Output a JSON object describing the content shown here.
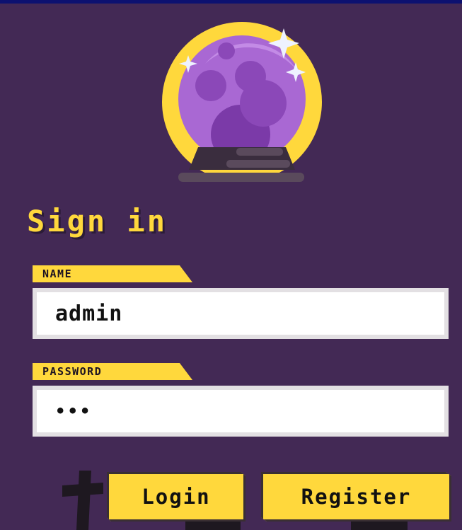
{
  "page": {
    "title": "Sign in"
  },
  "form": {
    "name_label": "NAME",
    "name_value": "admin",
    "password_label": "PASSWORD",
    "password_value": "•••"
  },
  "actions": {
    "login_label": "Login",
    "register_label": "Register"
  },
  "decor": {
    "logo_icon": "crystal-ball-icon",
    "grave_icon": "grave-cross-icon"
  },
  "colors": {
    "background": "#432955",
    "accent": "#ffd83c",
    "top_bar": "#0d1170",
    "input_border": "#e3e0e3",
    "ball_purple": "#9b59c8"
  }
}
